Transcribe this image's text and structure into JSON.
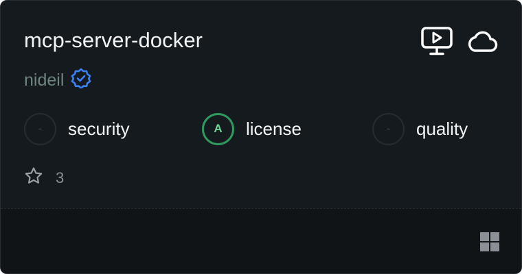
{
  "card": {
    "title": "mcp-server-docker",
    "author": "nideil",
    "verified_icon": "verified-badge-icon",
    "top_icons": [
      "local-monitor-icon",
      "cloud-icon"
    ],
    "metrics": [
      {
        "grade": "-",
        "label": "security"
      },
      {
        "grade": "A",
        "label": "license"
      },
      {
        "grade": "-",
        "label": "quality"
      }
    ],
    "stars": "3",
    "platform_icon": "windows-icon"
  },
  "colors": {
    "background": "#151a1e",
    "footer": "#101416",
    "verified": "#3b82f6",
    "grade_ok": "#2f9a5e"
  }
}
